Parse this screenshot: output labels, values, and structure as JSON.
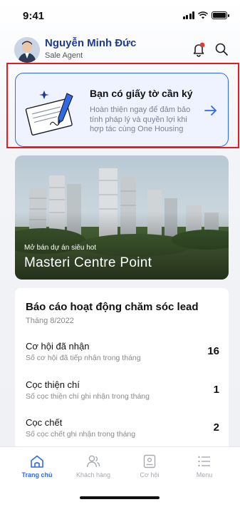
{
  "status_bar": {
    "time": "9:41"
  },
  "header": {
    "user_name": "Nguyễn Minh Đức",
    "user_role": "Sale Agent",
    "icons": [
      "bell-icon",
      "search-icon"
    ],
    "notification_dot_color": "#e53935"
  },
  "sign_card": {
    "title": "Bạn có giấy tờ cần ký",
    "description": "Hoàn thiện ngay để đảm bảo tính pháp lý và quyền lợi khi hợp tác cùng One Housing",
    "accent_color": "#2f6be6"
  },
  "banner": {
    "subtitle": "Mở bán dự án siêu hot",
    "title": "Masteri Centre Point"
  },
  "report": {
    "title": "Báo cáo hoạt động chăm sóc lead",
    "date": "Tháng 8/2022",
    "rows": [
      {
        "title": "Cơ hội đã nhận",
        "subtitle": "Số cơ hội đã tiếp nhận trong tháng",
        "count": "16"
      },
      {
        "title": "Cọc thiện chí",
        "subtitle": "Số cọc thiện chí ghi nhận trong tháng",
        "count": "1"
      },
      {
        "title": "Cọc chết",
        "subtitle": "Số cọc chết ghi nhận trong tháng",
        "count": "2"
      }
    ]
  },
  "tabbar": {
    "tabs": [
      {
        "label": "Trang chủ",
        "icon": "home-icon",
        "active": true
      },
      {
        "label": "Khách hàng",
        "icon": "customers-icon",
        "active": false
      },
      {
        "label": "Cơ hội",
        "icon": "opportunity-icon",
        "active": false
      },
      {
        "label": "Menu",
        "icon": "menu-icon",
        "active": false
      }
    ],
    "active_color": "#2f6be6"
  }
}
